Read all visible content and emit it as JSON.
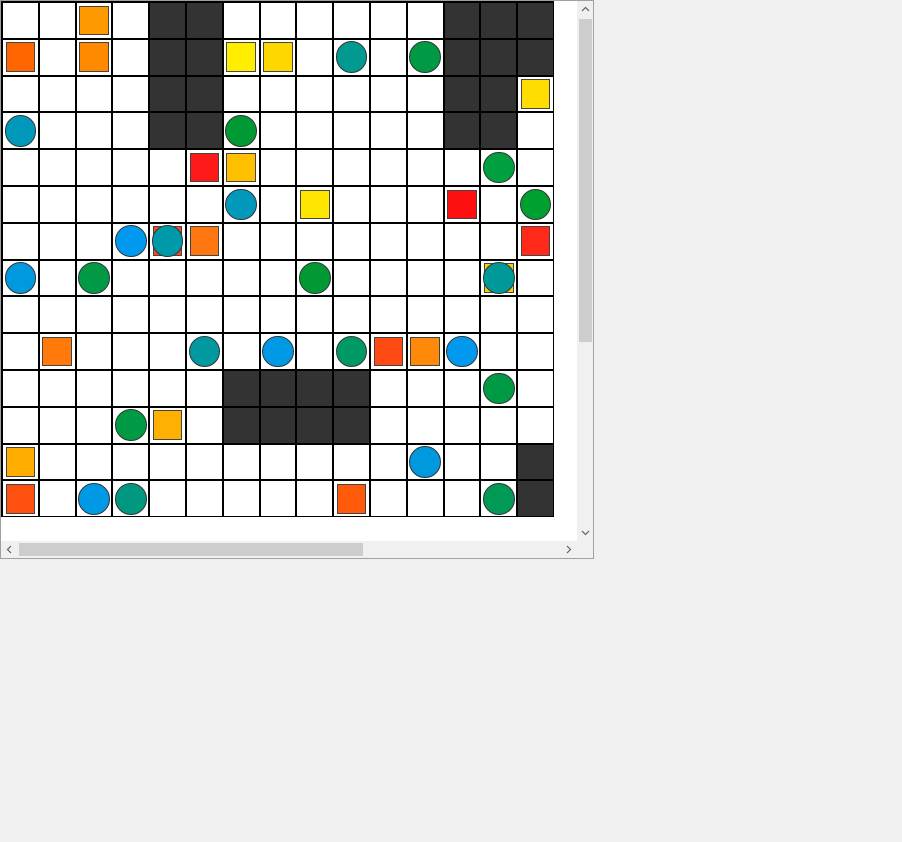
{
  "board": {
    "rows": 14,
    "cols": 15,
    "walls": [
      [
        0,
        4
      ],
      [
        0,
        5
      ],
      [
        0,
        12
      ],
      [
        0,
        13
      ],
      [
        0,
        14
      ],
      [
        1,
        4
      ],
      [
        1,
        5
      ],
      [
        1,
        12
      ],
      [
        1,
        13
      ],
      [
        1,
        14
      ],
      [
        2,
        4
      ],
      [
        2,
        5
      ],
      [
        2,
        12
      ],
      [
        2,
        13
      ],
      [
        3,
        4
      ],
      [
        3,
        5
      ],
      [
        3,
        12
      ],
      [
        3,
        13
      ],
      [
        10,
        6
      ],
      [
        10,
        7
      ],
      [
        10,
        8
      ],
      [
        10,
        9
      ],
      [
        11,
        6
      ],
      [
        11,
        7
      ],
      [
        11,
        8
      ],
      [
        11,
        9
      ],
      [
        12,
        14
      ],
      [
        13,
        14
      ]
    ],
    "squares": [
      {
        "r": 0,
        "c": 2,
        "color": "#ff9900"
      },
      {
        "r": 1,
        "c": 0,
        "color": "#ff6600"
      },
      {
        "r": 1,
        "c": 2,
        "color": "#ff8a00"
      },
      {
        "r": 1,
        "c": 6,
        "color": "#ffee00"
      },
      {
        "r": 1,
        "c": 7,
        "color": "#ffd700"
      },
      {
        "r": 2,
        "c": 14,
        "color": "#ffdd00"
      },
      {
        "r": 4,
        "c": 5,
        "color": "#ff1a1a"
      },
      {
        "r": 4,
        "c": 6,
        "color": "#ffc000"
      },
      {
        "r": 5,
        "c": 8,
        "color": "#ffe600"
      },
      {
        "r": 5,
        "c": 12,
        "color": "#ff1010"
      },
      {
        "r": 6,
        "c": 4,
        "color": "#ff4422"
      },
      {
        "r": 6,
        "c": 5,
        "color": "#ff7711"
      },
      {
        "r": 6,
        "c": 14,
        "color": "#ff2a1a"
      },
      {
        "r": 7,
        "c": 13,
        "color": "#ffd000"
      },
      {
        "r": 9,
        "c": 1,
        "color": "#ff7a0a"
      },
      {
        "r": 9,
        "c": 10,
        "color": "#ff4a14"
      },
      {
        "r": 9,
        "c": 11,
        "color": "#ff8a0a"
      },
      {
        "r": 11,
        "c": 4,
        "color": "#ffb000"
      },
      {
        "r": 12,
        "c": 0,
        "color": "#ffae00"
      },
      {
        "r": 13,
        "c": 0,
        "color": "#ff5010"
      },
      {
        "r": 13,
        "c": 9,
        "color": "#ff5a0a"
      }
    ],
    "circles": [
      {
        "r": 1,
        "c": 9,
        "color": "#009a90"
      },
      {
        "r": 1,
        "c": 11,
        "color": "#009944"
      },
      {
        "r": 3,
        "c": 0,
        "color": "#0099bb"
      },
      {
        "r": 3,
        "c": 6,
        "color": "#009933"
      },
      {
        "r": 4,
        "c": 13,
        "color": "#00a040"
      },
      {
        "r": 5,
        "c": 6,
        "color": "#0099bb"
      },
      {
        "r": 5,
        "c": 14,
        "color": "#00a030"
      },
      {
        "r": 6,
        "c": 3,
        "color": "#0099ee"
      },
      {
        "r": 6,
        "c": 4,
        "color": "#0099aa"
      },
      {
        "r": 7,
        "c": 0,
        "color": "#0099dd"
      },
      {
        "r": 7,
        "c": 2,
        "color": "#009944"
      },
      {
        "r": 7,
        "c": 8,
        "color": "#009933"
      },
      {
        "r": 7,
        "c": 13,
        "color": "#009999"
      },
      {
        "r": 9,
        "c": 5,
        "color": "#0099a0"
      },
      {
        "r": 9,
        "c": 7,
        "color": "#0099e6"
      },
      {
        "r": 9,
        "c": 9,
        "color": "#009966"
      },
      {
        "r": 9,
        "c": 12,
        "color": "#0099ee"
      },
      {
        "r": 10,
        "c": 13,
        "color": "#009944"
      },
      {
        "r": 11,
        "c": 3,
        "color": "#009944"
      },
      {
        "r": 12,
        "c": 11,
        "color": "#0099dd"
      },
      {
        "r": 13,
        "c": 2,
        "color": "#0099e6"
      },
      {
        "r": 13,
        "c": 3,
        "color": "#009980"
      },
      {
        "r": 13,
        "c": 13,
        "color": "#009955"
      }
    ]
  },
  "scrollbars": {
    "vertical": {
      "position": 0.0,
      "visible_fraction": 0.63
    },
    "horizontal": {
      "position": 0.0,
      "visible_fraction": 0.63
    }
  }
}
